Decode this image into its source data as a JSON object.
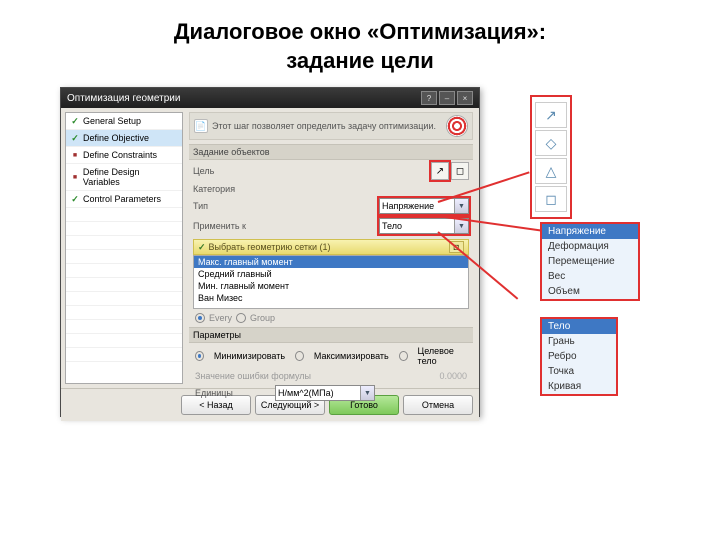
{
  "slide": {
    "title_line1": "Диалоговое окно «Оптимизация»:",
    "title_line2": "задание цели"
  },
  "dialog": {
    "title": "Оптимизация геометрии",
    "win_buttons": {
      "help": "?",
      "min": "–",
      "close": "×"
    },
    "sidebar": [
      {
        "label": "General Setup",
        "status": "ok"
      },
      {
        "label": "Define Objective",
        "status": "ok",
        "selected": true
      },
      {
        "label": "Define Constraints",
        "status": "req"
      },
      {
        "label": "Define Design Variables",
        "status": "req"
      },
      {
        "label": "Control Parameters",
        "status": "ok"
      }
    ],
    "hint": "Этот шаг позволяет определить задачу оптимизации.",
    "section_objects": "Задание объектов",
    "fields": {
      "goal": "Цель",
      "category": "Категория",
      "type": "Тип",
      "type_value": "Напряжение",
      "apply": "Применить к",
      "apply_value": "Тело"
    },
    "geom_select": {
      "label": "Выбрать геометрию сетки (1)",
      "count": ""
    },
    "moment_list": [
      "Макс. главный момент",
      "Средний главный",
      "Мин. главный момент",
      "Ван Мизес"
    ],
    "moment_selected": 0,
    "every_group": {
      "every": "Every",
      "group": "Group"
    },
    "params_header": "Параметры",
    "optimize": {
      "min": "Минимизировать",
      "max": "Максимизировать",
      "target": "Целевое тело"
    },
    "formula": {
      "label": "Значение ошибки формулы",
      "value": "0.0000"
    },
    "units": {
      "label": "Единицы",
      "value": "Н/мм^2(МПа)"
    },
    "buttons": {
      "back": "< Назад",
      "next": "Следующий >",
      "finish": "Готово",
      "cancel": "Отмена"
    }
  },
  "callouts": {
    "icons": [
      "↗",
      "◇",
      "△",
      "◻"
    ],
    "type_list": [
      "Напряжение",
      "Деформация",
      "Перемещение",
      "Вес",
      "Объем"
    ],
    "apply_list": [
      "Тело",
      "Грань",
      "Ребро",
      "Точка",
      "Кривая"
    ]
  }
}
